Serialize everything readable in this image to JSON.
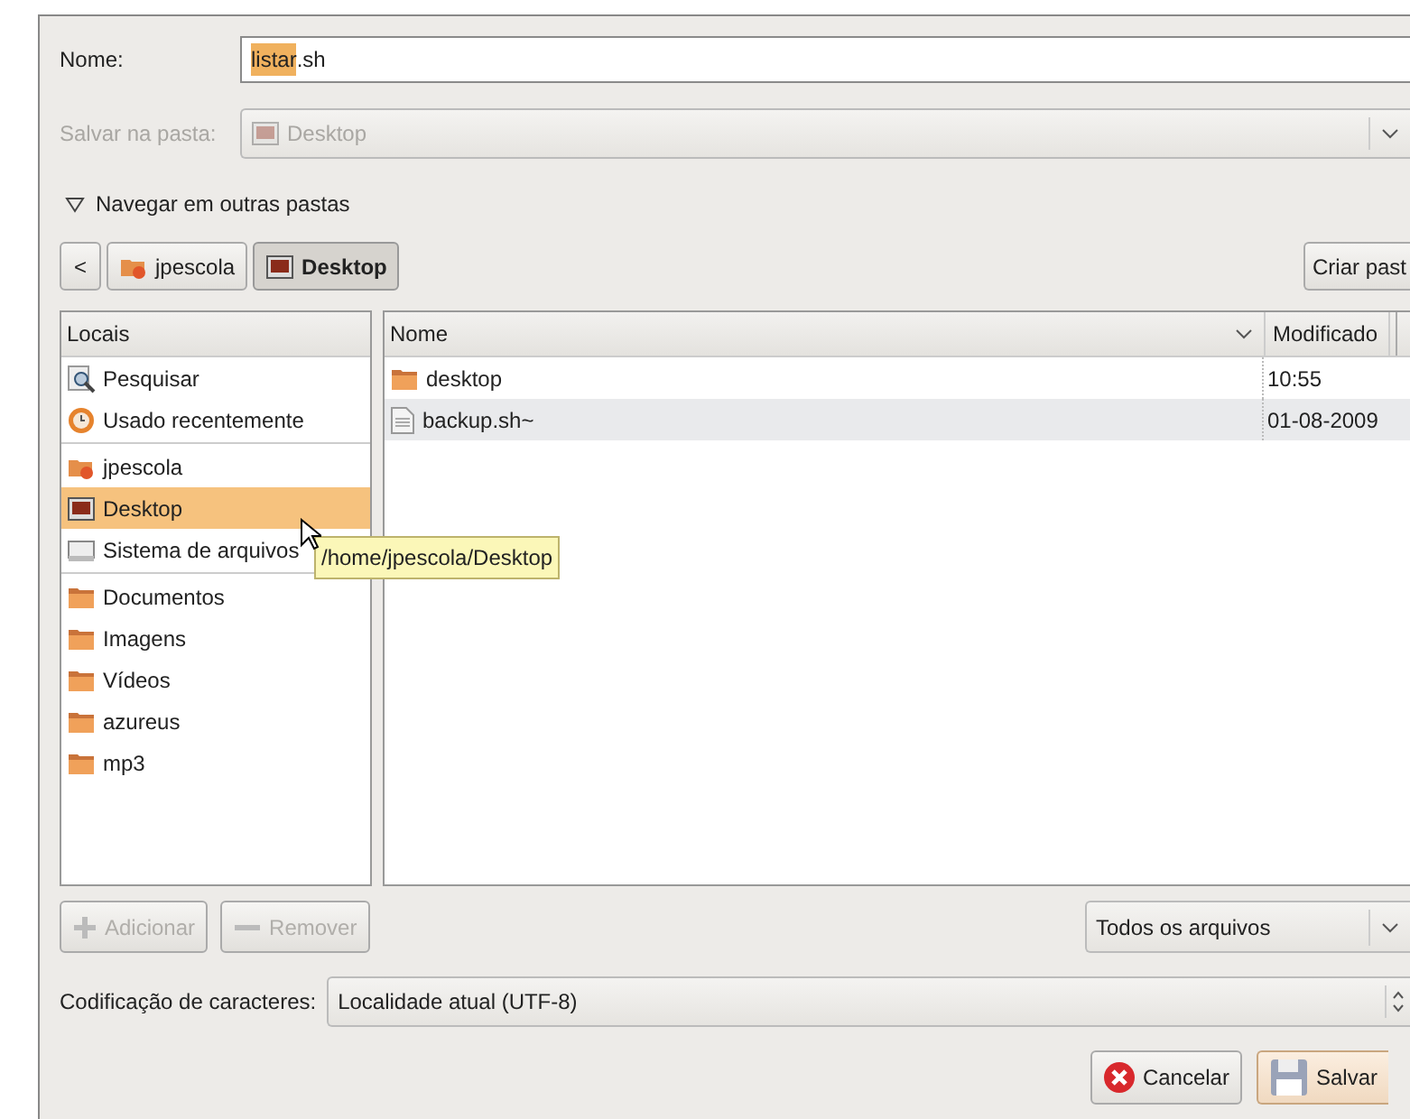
{
  "name_field": {
    "label": "Nome:",
    "selected_text": "listar",
    "rest_text": ".sh"
  },
  "save_folder": {
    "label": "Salvar na pasta:",
    "value": "Desktop",
    "disabled": true
  },
  "browse_toggle": {
    "label": "Navegar em outras pastas",
    "expanded": true
  },
  "path_bar": {
    "back": "<",
    "buttons": [
      {
        "label": "jpescola",
        "kind": "home",
        "selected": false
      },
      {
        "label": "Desktop",
        "kind": "desktop",
        "selected": true
      }
    ],
    "create_folder": "Criar past"
  },
  "places": {
    "header": "Locais",
    "sections": [
      [
        {
          "label": "Pesquisar",
          "kind": "search",
          "selected": false
        },
        {
          "label": "Usado recentemente",
          "kind": "recent",
          "selected": false
        }
      ],
      [
        {
          "label": "jpescola",
          "kind": "home",
          "selected": false
        },
        {
          "label": "Desktop",
          "kind": "desktop",
          "selected": true
        },
        {
          "label": "Sistema de arquivos",
          "kind": "drive",
          "selected": false
        }
      ],
      [
        {
          "label": "Documentos",
          "kind": "folder",
          "selected": false
        },
        {
          "label": "Imagens",
          "kind": "folder",
          "selected": false
        },
        {
          "label": "Vídeos",
          "kind": "folder",
          "selected": false
        },
        {
          "label": "azureus",
          "kind": "folder",
          "selected": false
        },
        {
          "label": "mp3",
          "kind": "folder",
          "selected": false
        }
      ]
    ]
  },
  "tooltip": "/home/jpescola/Desktop",
  "files": {
    "columns": [
      "Nome",
      "Modificado"
    ],
    "rows": [
      {
        "name": "desktop",
        "kind": "folder",
        "modified": "10:55"
      },
      {
        "name": "backup.sh~",
        "kind": "file",
        "modified": "01-08-2009"
      }
    ]
  },
  "place_buttons": [
    {
      "label": "Adicionar",
      "kind": "plus",
      "disabled": true
    },
    {
      "label": "Remover",
      "kind": "minus",
      "disabled": true
    }
  ],
  "filter": "Todos os arquivos",
  "encoding": {
    "label": "Codificação de caracteres:",
    "value": "Localidade atual (UTF-8)"
  },
  "actions": [
    {
      "label": "Cancelar",
      "kind": "cancel"
    },
    {
      "label": "Salvar",
      "kind": "save",
      "default": true
    }
  ]
}
